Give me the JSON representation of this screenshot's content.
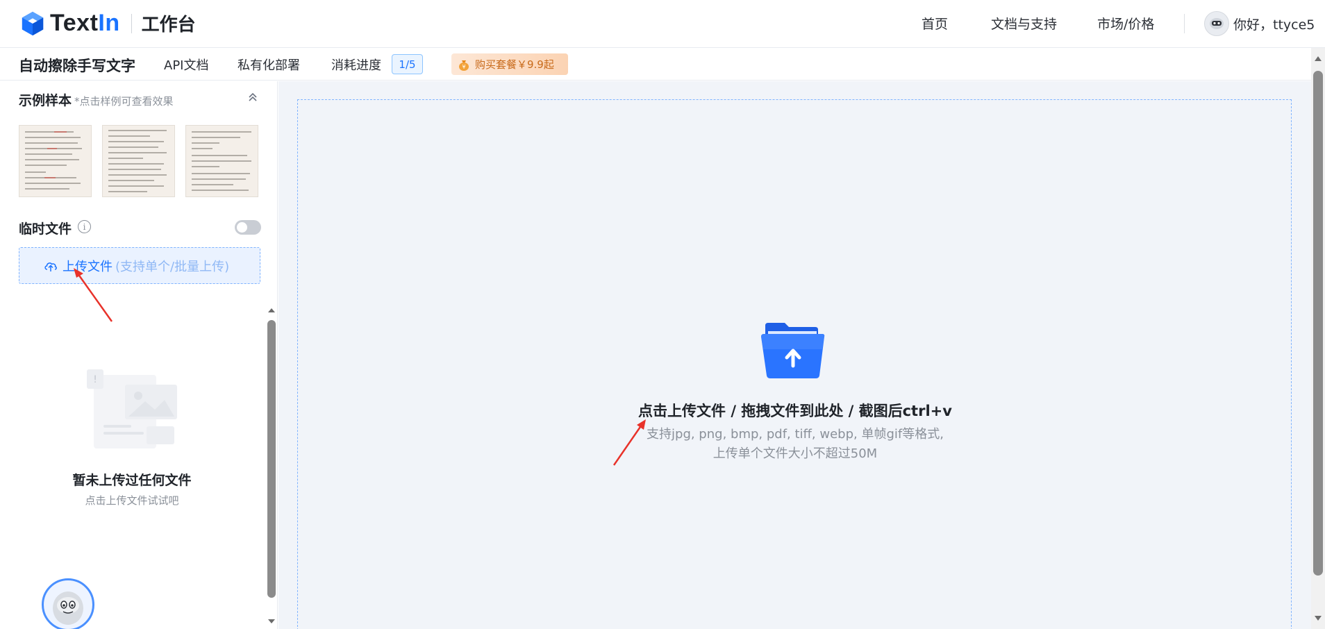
{
  "header": {
    "logo_text_a": "Text",
    "logo_text_b": "In",
    "workbench": "工作台",
    "nav": [
      "首页",
      "文档与支持",
      "市场/价格"
    ],
    "user_greeting": "你好，ttyce5"
  },
  "subbar": {
    "title": "自动擦除手写文字",
    "items": [
      "API文档",
      "私有化部署",
      "消耗进度"
    ],
    "progress_badge": "1/5",
    "promo": "购买套餐￥9.9起"
  },
  "left": {
    "samples_title": "示例样本",
    "samples_hint": "*点击样例可查看效果",
    "temp_label": "临时文件",
    "upload_label": "上传文件",
    "upload_hint": "(支持单个/批量上传)",
    "empty_title": "暂未上传过任何文件",
    "empty_sub": "点击上传文件试试吧"
  },
  "main": {
    "drop_title": "点击上传文件 / 拖拽文件到此处 / 截图后ctrl+v",
    "drop_sub_1": "支持jpg, png, bmp, pdf, tiff, webp, 单帧gif等格式,",
    "drop_sub_2": "上传单个文件大小不超过50M"
  },
  "colors": {
    "brand": "#1a73ff",
    "annotation_arrow": "#e8322a"
  }
}
